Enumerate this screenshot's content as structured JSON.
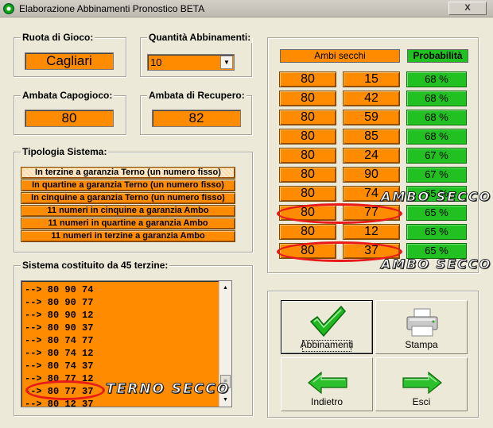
{
  "window": {
    "title": "Elaborazione Abbinamenti Pronostico BETA",
    "close_label": "X"
  },
  "ruota": {
    "label": "Ruota di Gioco:",
    "value": "Cagliari"
  },
  "quantita": {
    "label": "Quantità Abbinamenti:",
    "value": "10"
  },
  "ambata_capo": {
    "label": "Ambata Capogioco:",
    "value": "80"
  },
  "ambata_recupero": {
    "label": "Ambata di Recupero:",
    "value": "82"
  },
  "tipologia": {
    "label": "Tipologia Sistema:",
    "options": [
      "In terzine a garanzia Terno (un numero fisso)",
      "In quartine a garanzia Terno (un numero fisso)",
      "In cinquine a garanzia Terno (un numero fisso)",
      "11 numeri in cinquine a garanzia Ambo",
      "11 numeri in quartine a garanzia Ambo",
      "11 numeri in terzine a garanzia Ambo"
    ],
    "selected_index": 0
  },
  "sistema": {
    "label": "Sistema costituito da 45 terzine:",
    "items": [
      "--> 80 90 74",
      "--> 80 90 77",
      "--> 80 90 12",
      "--> 80 90 37",
      "--> 80 74 77",
      "--> 80 74 12",
      "--> 80 74 37",
      "--> 80 77 12",
      "--> 80 77 37",
      "--> 80 12 37"
    ]
  },
  "ambi": {
    "header": "Ambi secchi",
    "prob_header": "Probabilità",
    "rows": [
      {
        "a": "80",
        "b": "15",
        "p": "68 %"
      },
      {
        "a": "80",
        "b": "42",
        "p": "68 %"
      },
      {
        "a": "80",
        "b": "59",
        "p": "68 %"
      },
      {
        "a": "80",
        "b": "85",
        "p": "68 %"
      },
      {
        "a": "80",
        "b": "24",
        "p": "67 %"
      },
      {
        "a": "80",
        "b": "90",
        "p": "67 %"
      },
      {
        "a": "80",
        "b": "74",
        "p": "65 %"
      },
      {
        "a": "80",
        "b": "77",
        "p": "65 %"
      },
      {
        "a": "80",
        "b": "12",
        "p": "65 %"
      },
      {
        "a": "80",
        "b": "37",
        "p": "65 %"
      }
    ]
  },
  "annotations": {
    "ambo_secco": "AMBO SECCO",
    "terno_secco": "TERNO SECCO"
  },
  "buttons": {
    "abbinamenti": "Abbinamenti",
    "stampa": "Stampa",
    "indietro": "Indietro",
    "esci": "Esci"
  },
  "colors": {
    "orange": "#ff8c00",
    "green": "#22c122",
    "annotation_red": "#e81919"
  }
}
